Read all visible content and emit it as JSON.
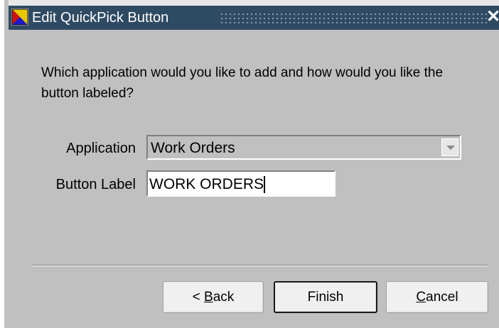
{
  "window": {
    "title": "Edit QuickPick Button",
    "icon": "oracle-forms-icon",
    "close_glyph": "✕"
  },
  "prompt": "Which application would you like to add and how would you like the button labeled?",
  "form": {
    "application_label": "Application",
    "application_value": "Work Orders",
    "button_label_label": "Button Label",
    "button_label_value": "WORK ORDERS"
  },
  "buttons": {
    "back_prefix": "< ",
    "back_mnemonic": "B",
    "back_rest": "ack",
    "finish": "Finish",
    "cancel_mnemonic": "C",
    "cancel_rest": "ancel"
  },
  "colors": {
    "titlebar": "#2f4b63",
    "dialog_bg": "#c0c0c0"
  }
}
